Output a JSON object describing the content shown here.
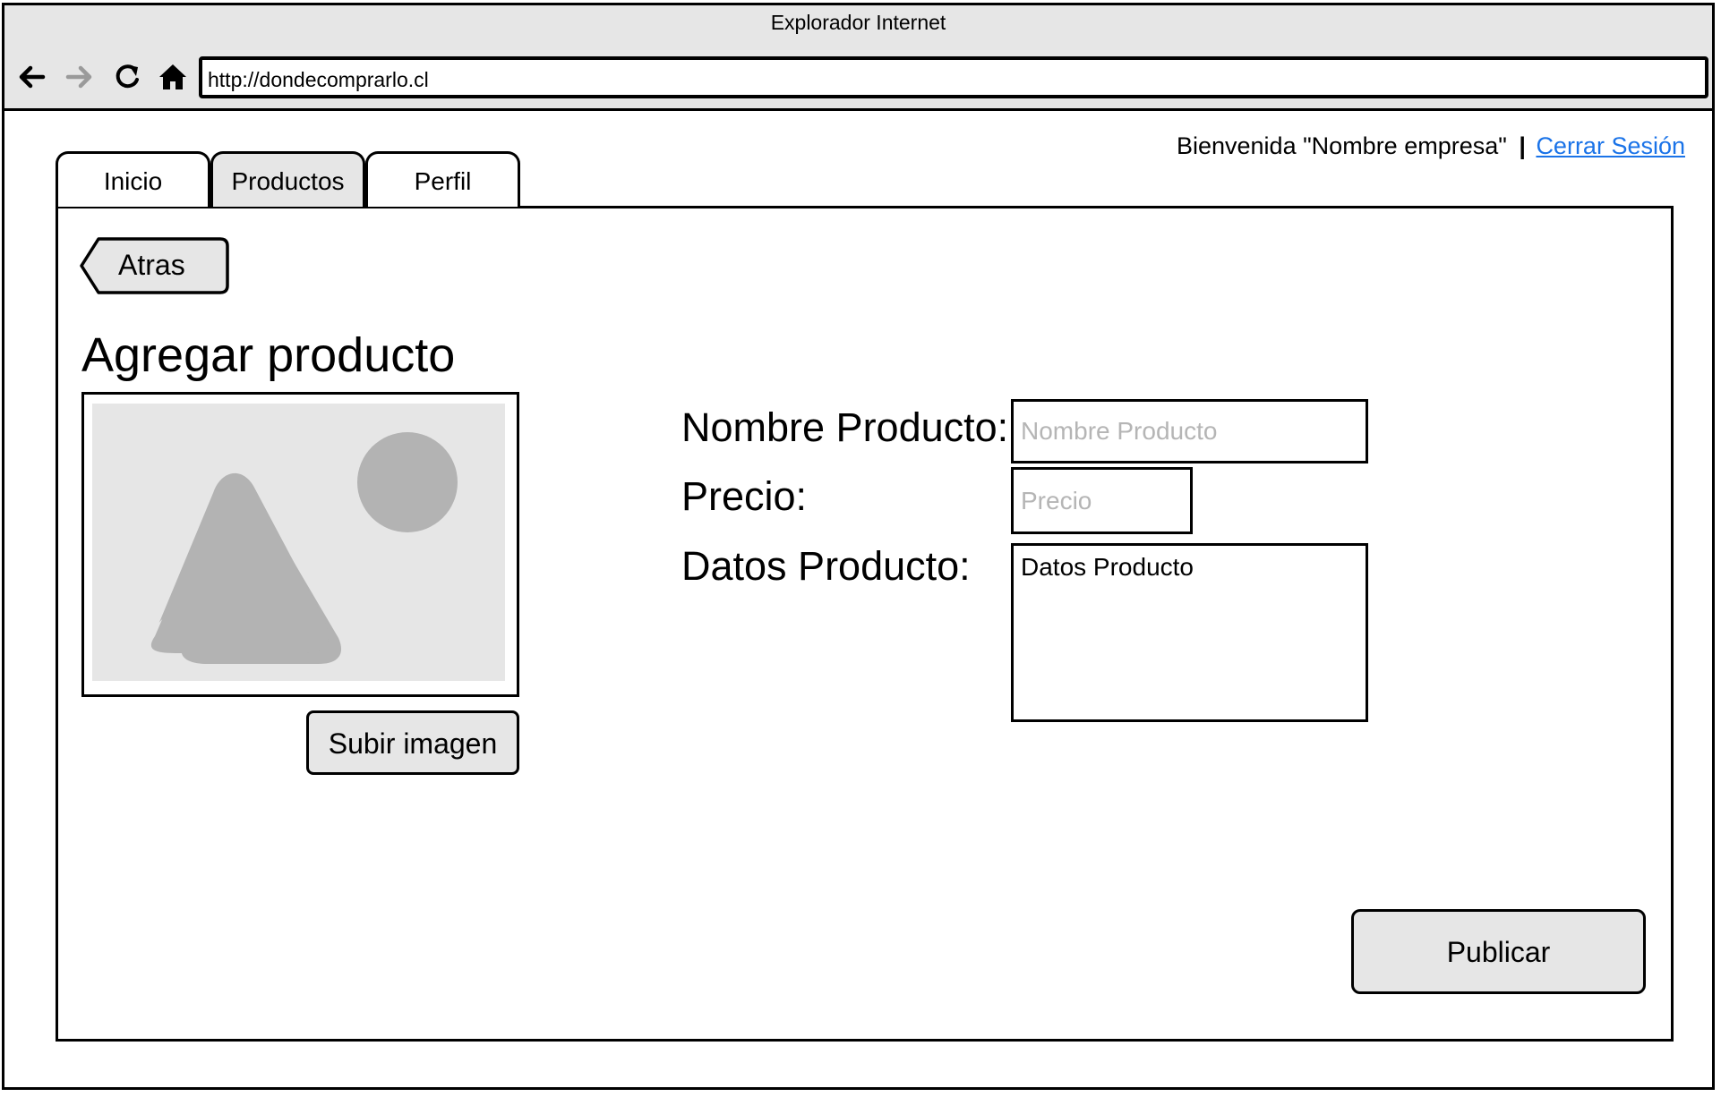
{
  "browser": {
    "title": "Explorador Internet",
    "url": "http://dondecomprarlo.cl"
  },
  "header": {
    "welcome": "Bienvenida \"Nombre empresa\"",
    "separator": "|",
    "logout": "Cerrar Sesión"
  },
  "tabs": [
    {
      "label": "Inicio",
      "active": true
    },
    {
      "label": "Productos",
      "active": false
    },
    {
      "label": "Perfil",
      "active": true
    }
  ],
  "main": {
    "back_label": "Atras",
    "title": "Agregar producto",
    "upload_label": "Subir imagen",
    "publish_label": "Publicar"
  },
  "form": {
    "name_label": "Nombre Producto:",
    "name_placeholder": "Nombre Producto",
    "price_label": "Precio:",
    "price_placeholder": "Precio",
    "details_label": "Datos Producto:",
    "details_value": "Datos Producto"
  },
  "icons": {
    "back": "arrow-left-icon",
    "forward": "arrow-right-icon",
    "reload": "reload-icon",
    "home": "home-icon",
    "image": "image-placeholder-icon"
  },
  "colors": {
    "chrome": "#e6e6e6",
    "link": "#1a73e8",
    "placeholder": "#b5b5b5",
    "image_shape": "#b3b3b3"
  }
}
